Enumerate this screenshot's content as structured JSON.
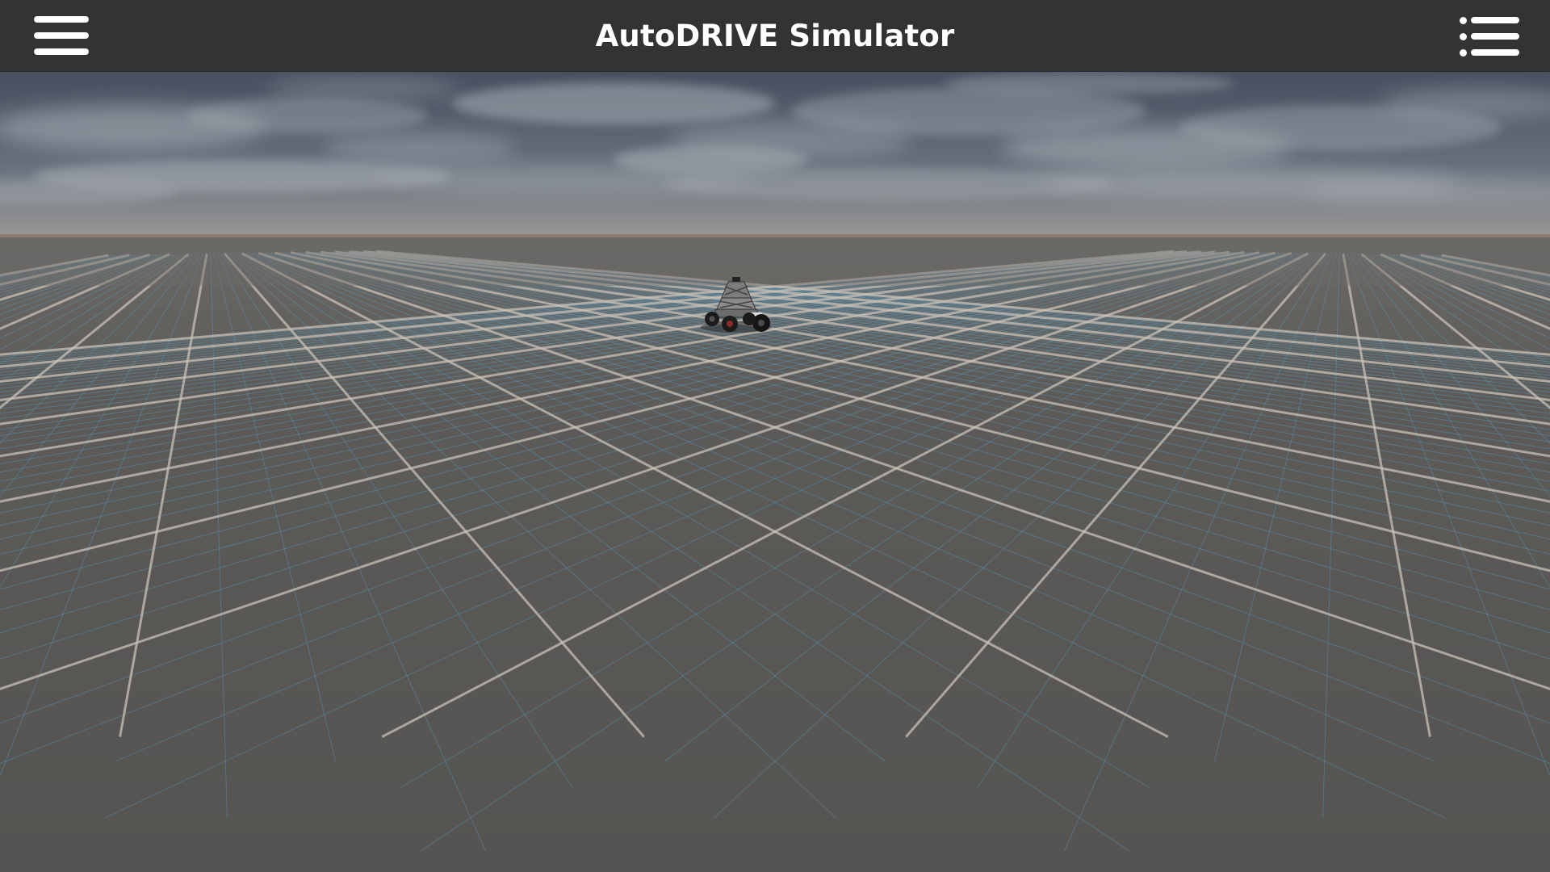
{
  "app": {
    "title": "AutoDRIVE Simulator"
  },
  "toolbar": {
    "left_button_icon": "hamburger-menu-icon",
    "right_button_icon": "list-menu-icon"
  },
  "scene": {
    "sky_color": "#4a5565",
    "cloud_color": "#b8bcc2",
    "horizon_color": "#8a7a70",
    "ground_color": "#5a5a58",
    "major_grid_color": "#c9c2b8",
    "minor_grid_color": "#5aa9d6",
    "object": "vehicle"
  }
}
